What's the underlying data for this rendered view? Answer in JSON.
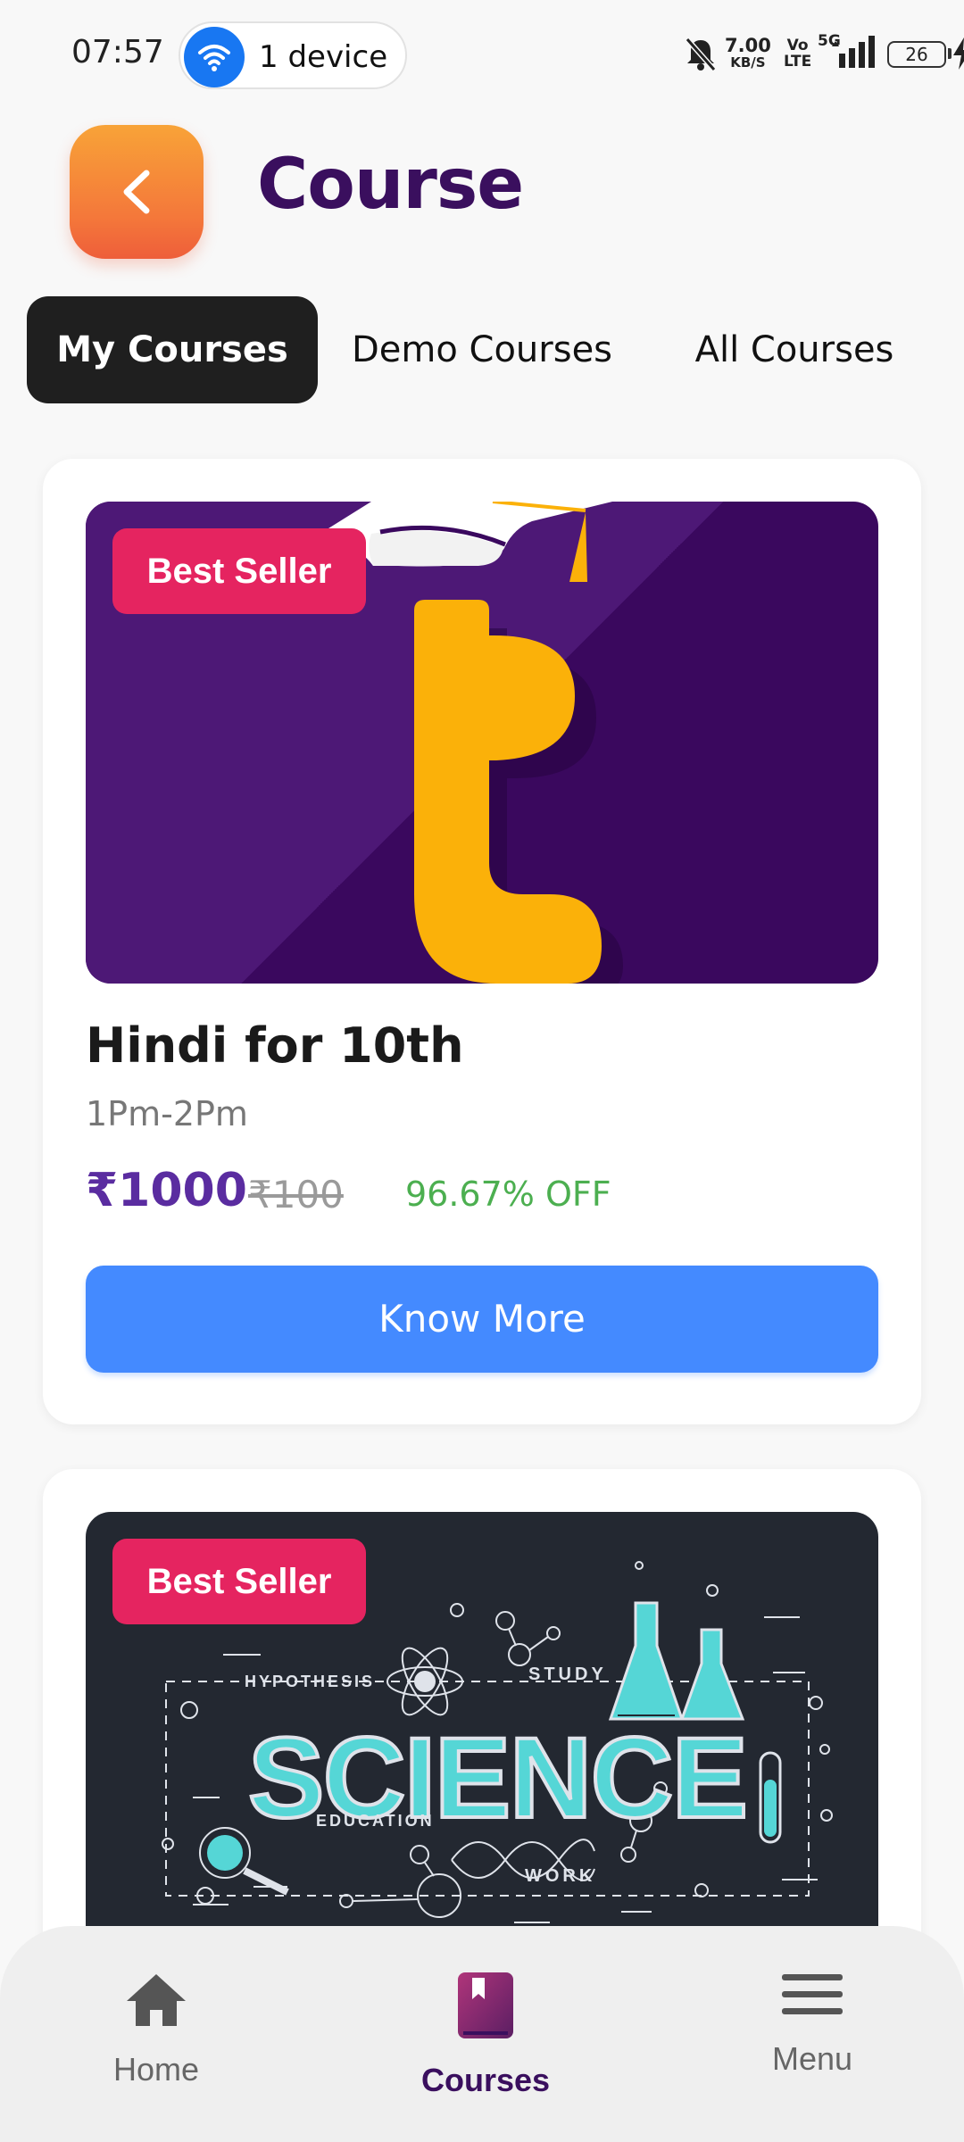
{
  "status_bar": {
    "time": "07:57",
    "device_label": "1 device",
    "net_speed_value": "7.00",
    "net_speed_unit": "KB/S",
    "volte_top": "Vo",
    "volte_bottom": "LTE",
    "net_type": "5G",
    "battery": "26"
  },
  "header": {
    "title": "Course",
    "back_icon": "chevron-left-icon"
  },
  "tabs": [
    {
      "label": "My Courses",
      "active": true
    },
    {
      "label": "Demo Courses",
      "active": false
    },
    {
      "label": "All Courses",
      "active": false
    }
  ],
  "courses": [
    {
      "badge": "Best Seller",
      "title": "Hindi for 10th",
      "time": "1Pm-2Pm",
      "price": "₹1000",
      "original_price": "₹100",
      "discount": "96.67% OFF",
      "button": "Know More"
    },
    {
      "badge": "Best Seller",
      "image_text": {
        "main": "SCIENCE",
        "hypothesis": "HYPOTHESIS",
        "study": "STUDY",
        "education": "EDUCATION",
        "work": "WORK"
      }
    }
  ],
  "bottom_nav": [
    {
      "label": "Home",
      "icon": "home-icon",
      "active": false
    },
    {
      "label": "Courses",
      "icon": "book-icon",
      "active": true
    },
    {
      "label": "Menu",
      "icon": "menu-icon",
      "active": false
    }
  ],
  "colors": {
    "title": "#3a0f5e",
    "badge": "#e52460",
    "price": "#5a2ca0",
    "discount": "#4caf50",
    "button": "#448aff",
    "back_button": "#f4773a"
  }
}
